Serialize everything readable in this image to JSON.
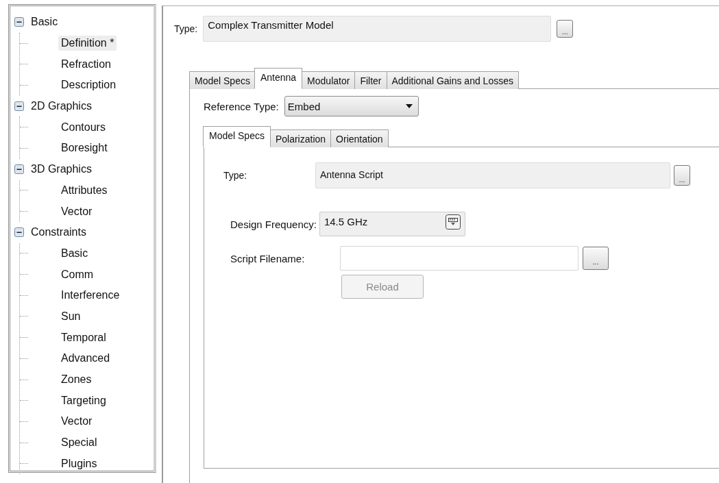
{
  "tree": [
    {
      "label": "Basic",
      "expanded": true,
      "selected": false,
      "children": [
        {
          "label": "Definition *",
          "selected": true
        },
        {
          "label": "Refraction",
          "selected": false
        },
        {
          "label": "Description",
          "selected": false
        }
      ]
    },
    {
      "label": "2D Graphics",
      "expanded": true,
      "selected": false,
      "children": [
        {
          "label": "Contours",
          "selected": false
        },
        {
          "label": "Boresight",
          "selected": false
        }
      ]
    },
    {
      "label": "3D Graphics",
      "expanded": true,
      "selected": false,
      "children": [
        {
          "label": "Attributes",
          "selected": false
        },
        {
          "label": "Vector",
          "selected": false
        }
      ]
    },
    {
      "label": "Constraints",
      "expanded": true,
      "selected": false,
      "children": [
        {
          "label": "Basic",
          "selected": false
        },
        {
          "label": "Comm",
          "selected": false
        },
        {
          "label": "Interference",
          "selected": false
        },
        {
          "label": "Sun",
          "selected": false
        },
        {
          "label": "Temporal",
          "selected": false
        },
        {
          "label": "Advanced",
          "selected": false
        },
        {
          "label": "Zones",
          "selected": false
        },
        {
          "label": "Targeting",
          "selected": false
        },
        {
          "label": "Vector",
          "selected": false
        },
        {
          "label": "Special",
          "selected": false
        },
        {
          "label": "Plugins",
          "selected": false
        }
      ]
    }
  ],
  "type_field": {
    "label": "Type:",
    "value": "Complex Transmitter Model",
    "button": "..."
  },
  "tabs": [
    {
      "label": "Model Specs",
      "selected": false
    },
    {
      "label": "Antenna",
      "selected": true
    },
    {
      "label": "Modulator",
      "selected": false
    },
    {
      "label": "Filter",
      "selected": false
    },
    {
      "label": "Additional Gains and Losses",
      "selected": false
    }
  ],
  "reference_type": {
    "label": "Reference Type:",
    "value": "Embed"
  },
  "inner_tabs": [
    {
      "label": "Model Specs",
      "selected": true
    },
    {
      "label": "Polarization",
      "selected": false
    },
    {
      "label": "Orientation",
      "selected": false
    }
  ],
  "antenna_type": {
    "label": "Type:",
    "value": "Antenna Script",
    "button": "..."
  },
  "design_frequency": {
    "label": "Design Frequency:",
    "value": "14.5 GHz"
  },
  "script_filename": {
    "label": "Script Filename:",
    "button": "..."
  },
  "reload_button": {
    "label": "Reload",
    "disabled": true
  }
}
